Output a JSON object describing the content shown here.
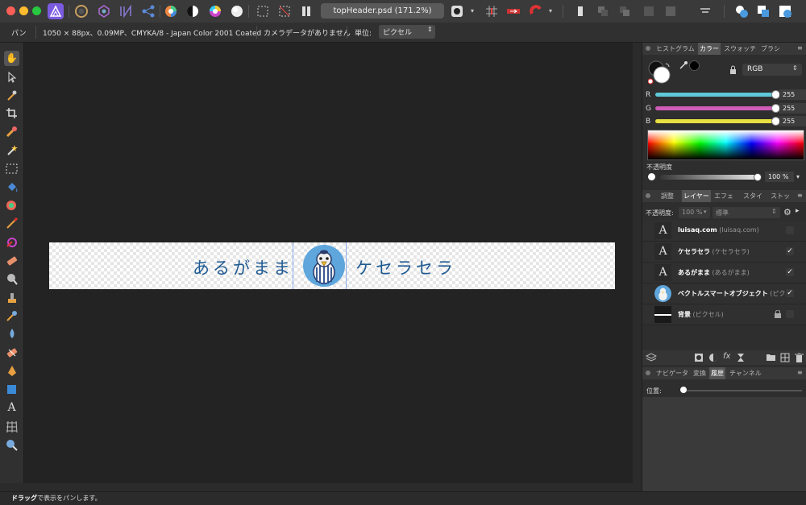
{
  "toolbar": {
    "document_title": "topHeader.psd (171.2%)"
  },
  "context_bar": {
    "tool_name": "パン",
    "doc_info": "1050 × 88px、0.09MP、CMYKA/8 - Japan Color 2001 Coated",
    "camera_info": "カメラデータがありません",
    "unit_label": "単位:",
    "unit_value": "ピクセル"
  },
  "canvas": {
    "text_left": "あるがまま",
    "text_right": "ケセラセラ"
  },
  "color_panel": {
    "tabs": [
      "ヒストグラム",
      "カラー",
      "スウォッチ",
      "ブラシ"
    ],
    "mode": "RGB",
    "channels": [
      {
        "label": "R",
        "value": "255",
        "color": "#5fc8d8"
      },
      {
        "label": "G",
        "value": "255",
        "color": "#d05cb8"
      },
      {
        "label": "B",
        "value": "255",
        "color": "#e8e040"
      }
    ],
    "opacity_label": "不透明度",
    "opacity_value": "100 %"
  },
  "layers_panel": {
    "tabs": [
      "調整",
      "レイヤー",
      "エフェ",
      "スタイ",
      "ストッ"
    ],
    "opacity_label": "不透明度:",
    "opacity_value": "100 %",
    "blend_mode": "標準",
    "layers": [
      {
        "name": "luisaq.com",
        "sub": "(luisaq.com)",
        "icon": "A",
        "visible": false,
        "locked": false
      },
      {
        "name": "ケセラセラ",
        "sub": "(ケセラセラ)",
        "icon": "A",
        "visible": true,
        "locked": false
      },
      {
        "name": "あるがまま",
        "sub": "(あるがまま)",
        "icon": "A",
        "visible": true,
        "locked": false
      },
      {
        "name": "ベクトルスマートオブジェクト",
        "sub": "(ピク",
        "icon": "img",
        "visible": true,
        "locked": false
      },
      {
        "name": "背景",
        "sub": "(ピクセル)",
        "icon": "line",
        "visible": false,
        "locked": true
      }
    ]
  },
  "bottom_panel": {
    "tabs": [
      "ナビゲータ",
      "変換",
      "履歴",
      "チャンネル"
    ],
    "position_label": "位置:"
  },
  "status_bar": {
    "bold": "ドラッグ",
    "text": "で表示をパンします。"
  }
}
